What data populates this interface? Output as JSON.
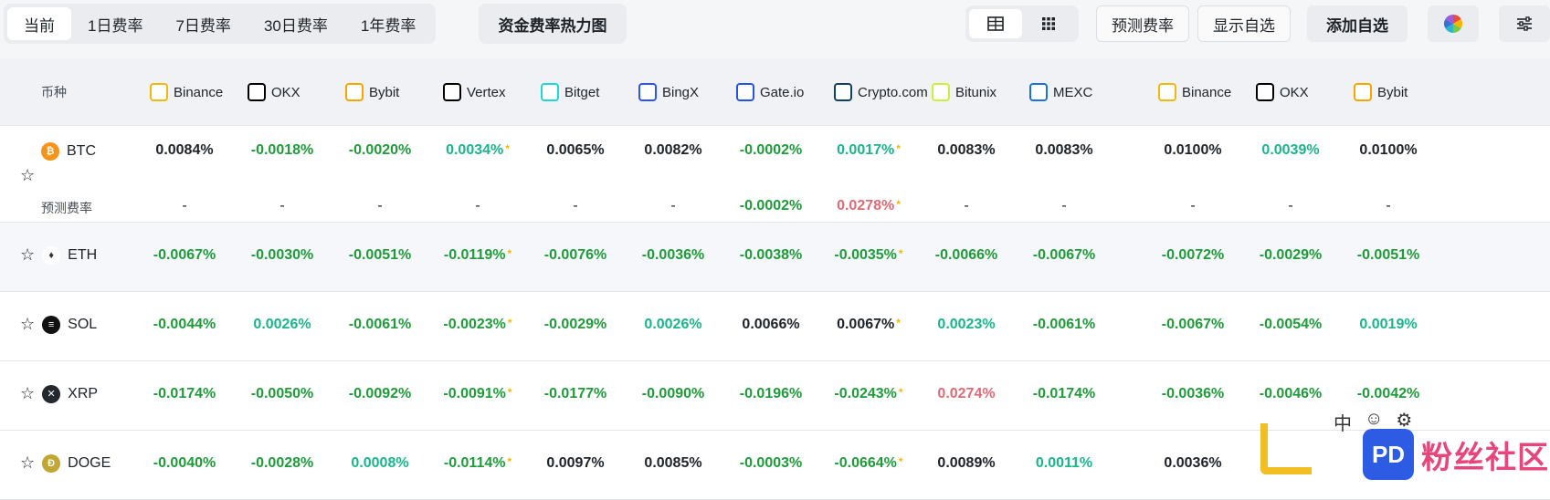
{
  "tabs": [
    {
      "label": "当前",
      "active": true
    },
    {
      "label": "1日费率",
      "active": false
    },
    {
      "label": "7日费率",
      "active": false
    },
    {
      "label": "30日费率",
      "active": false
    },
    {
      "label": "1年费率",
      "active": false
    }
  ],
  "heatmap_button": "资金费率热力图",
  "buttons": {
    "predict": "预测费率",
    "show_fav": "显示自选",
    "add_fav": "添加自选"
  },
  "header": {
    "coin_col": "币种",
    "exchanges": [
      {
        "name": "Binance",
        "icon": "binance-icon",
        "color": "#f0b90b"
      },
      {
        "name": "OKX",
        "icon": "okx-icon",
        "color": "#000000"
      },
      {
        "name": "Bybit",
        "icon": "bybit-icon",
        "color": "#f7a600"
      },
      {
        "name": "Vertex",
        "icon": "vertex-icon",
        "color": "#000000"
      },
      {
        "name": "Bitget",
        "icon": "bitget-icon",
        "color": "#1dd6d6"
      },
      {
        "name": "BingX",
        "icon": "bingx-icon",
        "color": "#2a54ff"
      },
      {
        "name": "Gate.io",
        "icon": "gateio-icon",
        "color": "#2354e6"
      },
      {
        "name": "Crypto.com",
        "icon": "cryptocom-icon",
        "color": "#103f68"
      },
      {
        "name": "Bitunix",
        "icon": "bitunix-icon",
        "color": "#c8f03c"
      },
      {
        "name": "MEXC",
        "icon": "mexc-icon",
        "color": "#1972e2"
      },
      {
        "name": "Binance",
        "icon": "binance-icon",
        "color": "#f0b90b"
      },
      {
        "name": "OKX",
        "icon": "okx-icon",
        "color": "#000000"
      },
      {
        "name": "Bybit",
        "icon": "bybit-icon",
        "color": "#f7a600"
      }
    ]
  },
  "rows": [
    {
      "coin": "BTC",
      "icon_color": "#f7931a",
      "icon_glyph": "₿",
      "values": [
        {
          "v": "0.0084%",
          "c": "black"
        },
        {
          "v": "-0.0018%",
          "c": "green"
        },
        {
          "v": "-0.0020%",
          "c": "green"
        },
        {
          "v": "0.0034%",
          "c": "teal",
          "mark": "*"
        },
        {
          "v": "0.0065%",
          "c": "black"
        },
        {
          "v": "0.0082%",
          "c": "black"
        },
        {
          "v": "-0.0002%",
          "c": "green"
        },
        {
          "v": "0.0017%",
          "c": "teal",
          "mark": "*"
        },
        {
          "v": "0.0083%",
          "c": "black"
        },
        {
          "v": "0.0083%",
          "c": "black"
        },
        {
          "v": "0.0100%",
          "c": "black"
        },
        {
          "v": "0.0039%",
          "c": "teal"
        },
        {
          "v": "0.0100%",
          "c": "black"
        }
      ],
      "predict_label": "预测费率",
      "predict": [
        {
          "v": "-"
        },
        {
          "v": "-"
        },
        {
          "v": "-"
        },
        {
          "v": "-"
        },
        {
          "v": "-"
        },
        {
          "v": "-"
        },
        {
          "v": "-0.0002%",
          "c": "green"
        },
        {
          "v": "0.0278%",
          "c": "red",
          "mark": "*"
        },
        {
          "v": "-"
        },
        {
          "v": "-"
        },
        {
          "v": "-"
        },
        {
          "v": "-"
        },
        {
          "v": "-"
        }
      ]
    },
    {
      "coin": "ETH",
      "icon_color": "#ffffff",
      "icon_glyph": "♦",
      "values": [
        {
          "v": "-0.0067%",
          "c": "green"
        },
        {
          "v": "-0.0030%",
          "c": "green"
        },
        {
          "v": "-0.0051%",
          "c": "green"
        },
        {
          "v": "-0.0119%",
          "c": "green",
          "mark": "*"
        },
        {
          "v": "-0.0076%",
          "c": "green"
        },
        {
          "v": "-0.0036%",
          "c": "green"
        },
        {
          "v": "-0.0038%",
          "c": "green"
        },
        {
          "v": "-0.0035%",
          "c": "green",
          "mark": "*"
        },
        {
          "v": "-0.0066%",
          "c": "green"
        },
        {
          "v": "-0.0067%",
          "c": "green"
        },
        {
          "v": "-0.0072%",
          "c": "green"
        },
        {
          "v": "-0.0029%",
          "c": "green"
        },
        {
          "v": "-0.0051%",
          "c": "green"
        }
      ]
    },
    {
      "coin": "SOL",
      "icon_color": "#111111",
      "icon_glyph": "≡",
      "values": [
        {
          "v": "-0.0044%",
          "c": "green"
        },
        {
          "v": "0.0026%",
          "c": "teal"
        },
        {
          "v": "-0.0061%",
          "c": "green"
        },
        {
          "v": "-0.0023%",
          "c": "green",
          "mark": "*"
        },
        {
          "v": "-0.0029%",
          "c": "green"
        },
        {
          "v": "0.0026%",
          "c": "teal"
        },
        {
          "v": "0.0066%",
          "c": "black"
        },
        {
          "v": "0.0067%",
          "c": "black",
          "mark": "*"
        },
        {
          "v": "0.0023%",
          "c": "teal"
        },
        {
          "v": "-0.0061%",
          "c": "green"
        },
        {
          "v": "-0.0067%",
          "c": "green"
        },
        {
          "v": "-0.0054%",
          "c": "green"
        },
        {
          "v": "0.0019%",
          "c": "teal"
        }
      ]
    },
    {
      "coin": "XRP",
      "icon_color": "#23292f",
      "icon_glyph": "✕",
      "values": [
        {
          "v": "-0.0174%",
          "c": "green"
        },
        {
          "v": "-0.0050%",
          "c": "green"
        },
        {
          "v": "-0.0092%",
          "c": "green"
        },
        {
          "v": "-0.0091%",
          "c": "green",
          "mark": "*"
        },
        {
          "v": "-0.0177%",
          "c": "green"
        },
        {
          "v": "-0.0090%",
          "c": "green"
        },
        {
          "v": "-0.0196%",
          "c": "green"
        },
        {
          "v": "-0.0243%",
          "c": "green",
          "mark": "*"
        },
        {
          "v": "0.0274%",
          "c": "red"
        },
        {
          "v": "-0.0174%",
          "c": "green"
        },
        {
          "v": "-0.0036%",
          "c": "green"
        },
        {
          "v": "-0.0046%",
          "c": "green"
        },
        {
          "v": "-0.0042%",
          "c": "green"
        }
      ]
    },
    {
      "coin": "DOGE",
      "icon_color": "#c2a633",
      "icon_glyph": "Ð",
      "values": [
        {
          "v": "-0.0040%",
          "c": "green"
        },
        {
          "v": "-0.0028%",
          "c": "green"
        },
        {
          "v": "0.0008%",
          "c": "teal"
        },
        {
          "v": "-0.0114%",
          "c": "green",
          "mark": "*"
        },
        {
          "v": "0.0097%",
          "c": "black"
        },
        {
          "v": "0.0085%",
          "c": "black"
        },
        {
          "v": "-0.0003%",
          "c": "green"
        },
        {
          "v": "-0.0664%",
          "c": "green",
          "mark": "*"
        },
        {
          "v": "0.0089%",
          "c": "black"
        },
        {
          "v": "0.0011%",
          "c": "teal"
        },
        {
          "v": "0.0036%",
          "c": "black"
        },
        {
          "v": "",
          "c": "black"
        },
        {
          "v": "",
          "c": "black"
        }
      ]
    }
  ],
  "watermark": {
    "logo_text": "PD",
    "text": "粉丝社区",
    "ime": "中"
  }
}
